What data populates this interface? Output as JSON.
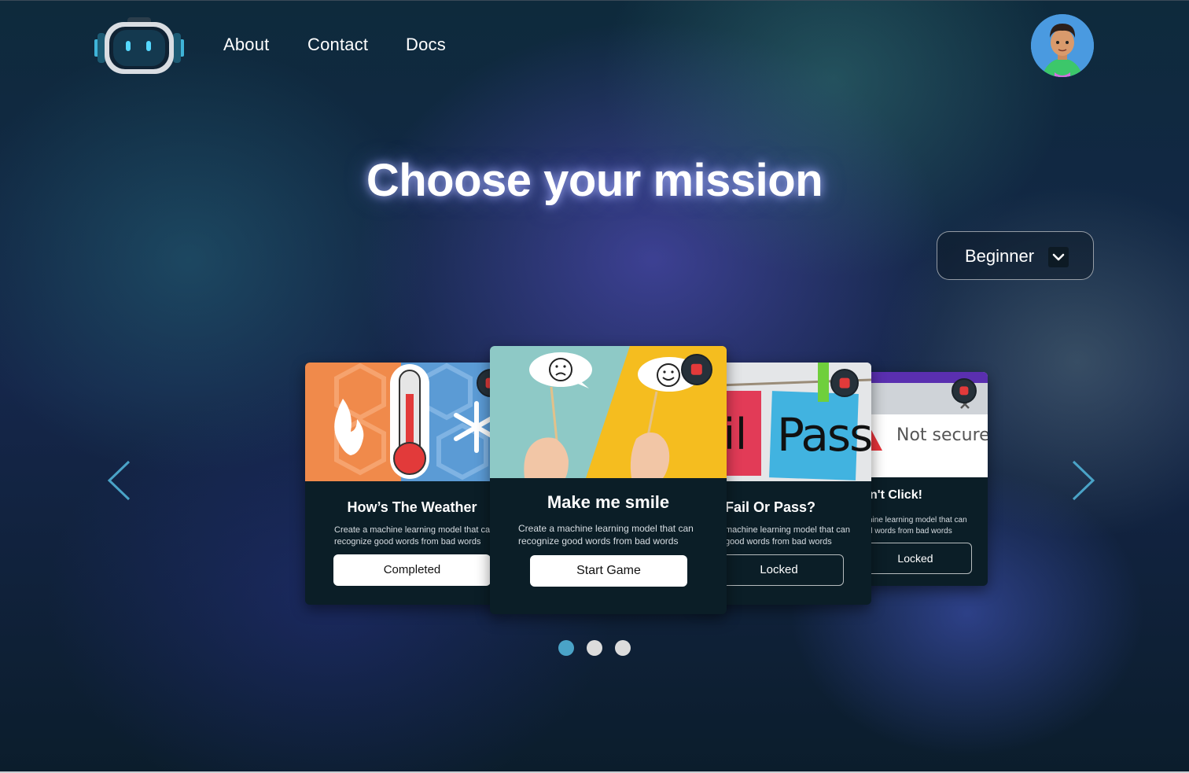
{
  "nav": {
    "links": [
      "About",
      "Contact",
      "Docs"
    ]
  },
  "icons": {
    "logo": "robot-logo-icon",
    "avatar": "user-avatar",
    "prev": "chevron-left-icon",
    "next": "chevron-right-icon",
    "dropdown": "chevron-down-icon",
    "lock": "lock-icon"
  },
  "page": {
    "title": "Choose your mission"
  },
  "level_select": {
    "value": "Beginner"
  },
  "missions": [
    {
      "title": "How’s The Weather",
      "desc_line1": "Create a machine learning model that can",
      "desc_line2": "recognize good words from bad words",
      "button": "Completed"
    },
    {
      "title": "Make me smile",
      "desc_line1": "Create a machine learning model that can",
      "desc_line2": "recognize good words from bad words",
      "button": "Start Game"
    },
    {
      "title": "Fail Or Pass?",
      "desc_line1": "machine learning model that can",
      "desc_line2": "good words from bad words",
      "button": "Locked",
      "img_text_left": "il",
      "img_text_right": "Pass"
    },
    {
      "title": "n't Click!",
      "desc_line1": "hine learning model that can",
      "desc_line2": "d words from bad words",
      "button": "Locked",
      "img_text": "Not secure"
    }
  ],
  "pagination": {
    "count": 3,
    "active": 1
  },
  "colors": {
    "accent": "#4aa3c7",
    "lock": "#e23a3a",
    "card_bg": "#0b1e27"
  }
}
